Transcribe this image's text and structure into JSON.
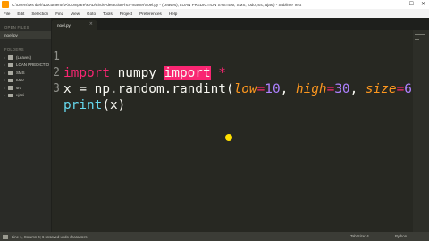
{
  "window": {
    "title": "C:\\Users\\Ms'Ibeh\\Documents\\A\\Compare\\RAD\\circle-detection-hcv-master\\noel.py - (Leaves), LOAN PREDICTION SYSTEM, SMS, todo, src, ujasi) - Sublime Text",
    "minimize": "—",
    "maximize": "☐",
    "close": "✕"
  },
  "menu": [
    "File",
    "Edit",
    "Selection",
    "Find",
    "View",
    "Goto",
    "Tools",
    "Project",
    "Preferences",
    "Help"
  ],
  "sidebar": {
    "open_files_header": "OPEN FILES",
    "open_file": "noel.py",
    "folders_header": "FOLDERS",
    "folders": [
      "(Leaves)",
      "LOAN PREDICTIO",
      "SMS",
      "todo",
      "src",
      "ujasi"
    ]
  },
  "tab": {
    "label": "noel.py",
    "close": "×"
  },
  "code": {
    "line1": {
      "num": "1",
      "kw1": "import",
      "mid": " numpy ",
      "kw2": "import",
      "rest": " *"
    },
    "line2": {
      "num": "2",
      "pre": "x = np.random.randint(",
      "p1": "low",
      "eq1": "=",
      "v1": "10",
      "sep1": ", ",
      "p2": "high",
      "eq2": "=",
      "v2": "30",
      "sep2": ", ",
      "p3": "size",
      "eq3": "=",
      "v3": "6",
      "close": ")"
    },
    "line3": {
      "num": "3",
      "fn": "print",
      "rest": "(x)"
    }
  },
  "status": {
    "left": "Line 1, Column 4; 6 unsaved undo characters",
    "spaces": "Tab Size: 4",
    "syntax": "Python"
  },
  "colors": {
    "background": "#272822",
    "keyword": "#f92672",
    "parameter": "#fd971f",
    "number": "#ae81ff",
    "function": "#66d9ef",
    "cursor_dot": "#ffe000"
  }
}
